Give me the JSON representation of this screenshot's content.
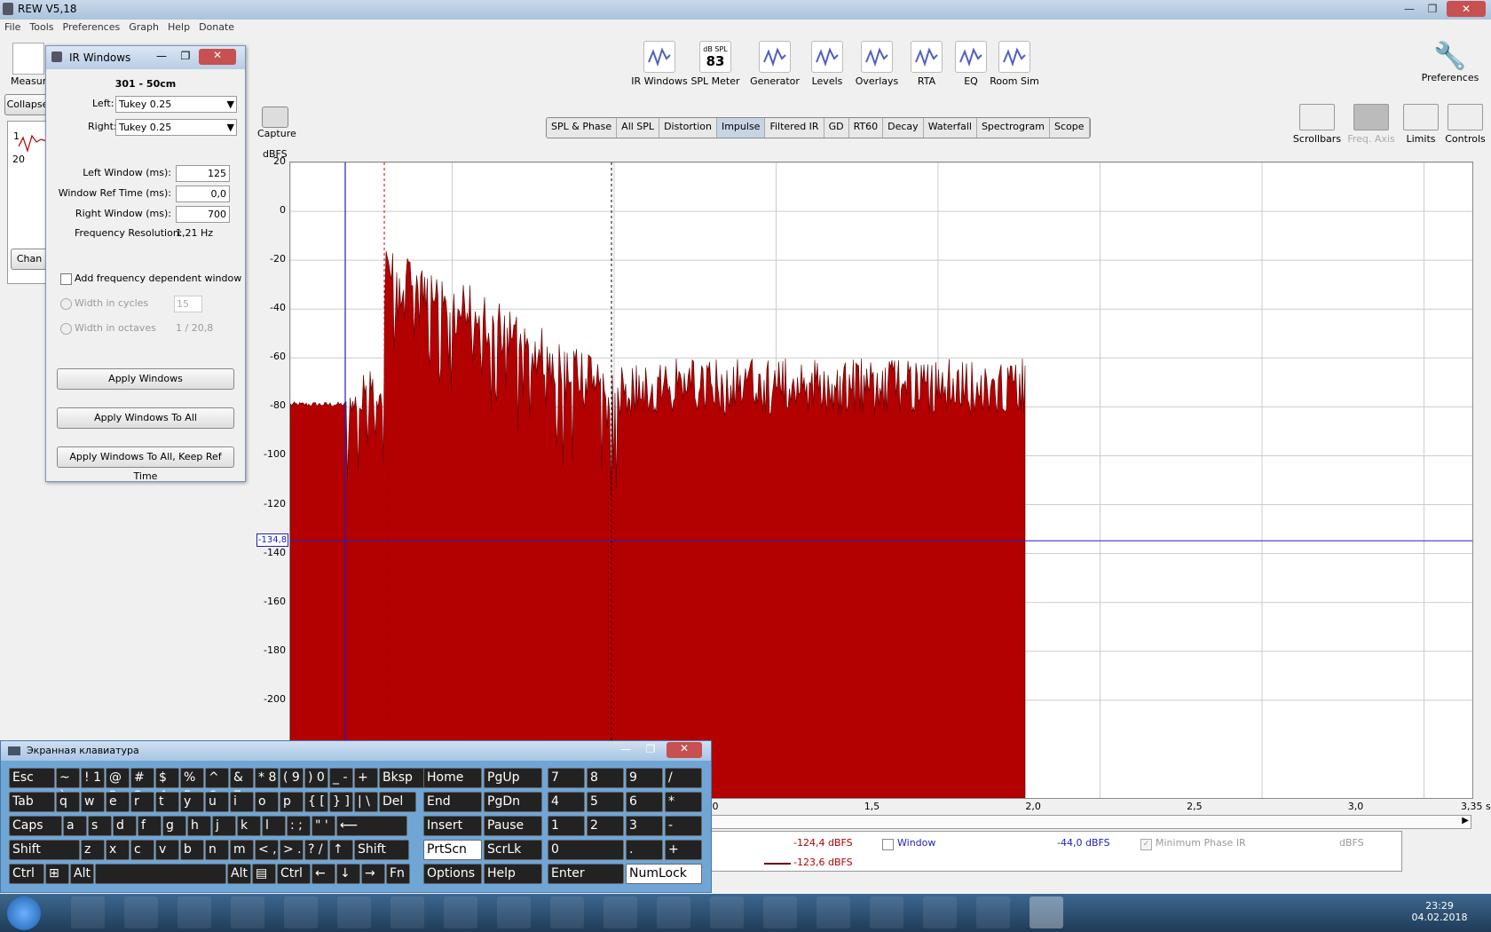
{
  "window": {
    "title": "REW V5,18"
  },
  "menu": [
    "File",
    "Tools",
    "Preferences",
    "Graph",
    "Help",
    "Donate"
  ],
  "toolbar": [
    {
      "label": "IR Windows",
      "icon": "ir-windows-icon",
      "x": 743
    },
    {
      "label": "SPL Meter",
      "icon": "spl-meter-icon",
      "x": 806,
      "sub": "dB SPL",
      "value": "83"
    },
    {
      "label": "Generator",
      "icon": "generator-icon",
      "x": 873
    },
    {
      "label": "Levels",
      "icon": "levels-icon",
      "x": 932
    },
    {
      "label": "Overlays",
      "icon": "overlays-icon",
      "x": 988
    },
    {
      "label": "RTA",
      "icon": "rta-icon",
      "x": 1044
    },
    {
      "label": "EQ",
      "icon": "eq-icon",
      "x": 1094
    },
    {
      "label": "Room Sim",
      "icon": "room-sim-icon",
      "x": 1143
    }
  ],
  "preferences_label": "Preferences",
  "capture": {
    "label": "Capture",
    "unit": "dBFS"
  },
  "tabs": [
    "SPL & Phase",
    "All SPL",
    "Distortion",
    "Impulse",
    "Filtered IR",
    "GD",
    "RT60",
    "Decay",
    "Waterfall",
    "Spectrogram",
    "Scope"
  ],
  "active_tab": "Impulse",
  "right_tools": [
    "Scrollbars",
    "Freq. Axis",
    "Limits",
    "Controls"
  ],
  "left_panel": {
    "measure": "Measure",
    "collapse": "Collapse",
    "change": "Chan",
    "small_tick_1": "1",
    "small_tick_20": "20"
  },
  "chart_data": {
    "type": "area",
    "ylabel": "dBFS",
    "xlabel": "s",
    "y_ticks": [
      20,
      0,
      -20,
      -40,
      -60,
      -80,
      -100,
      -120,
      -140,
      -160,
      -180,
      -200
    ],
    "x_ticks": [
      {
        "label": "1,0",
        "v": 1.0
      },
      {
        "label": "1,5",
        "v": 1.5
      },
      {
        "label": "2,0",
        "v": 2.0
      },
      {
        "label": "2,5",
        "v": 2.5
      },
      {
        "label": "3,0",
        "v": 3.0
      },
      {
        "label": "3,35 s",
        "v": 3.35
      }
    ],
    "cursor_readout": "-134,8",
    "color": "#b30000",
    "peak_db": 0
  },
  "ir_windows": {
    "title": "IR Windows",
    "measurement": "301 - 50cm",
    "left_label": "Left:",
    "left_value": "Tukey 0.25",
    "right_label": "Right:",
    "right_value": "Tukey 0.25",
    "left_window_label": "Left Window (ms):",
    "left_window_value": "125",
    "ref_time_label": "Window Ref Time (ms):",
    "ref_time_value": "0,0",
    "right_window_label": "Right Window (ms):",
    "right_window_value": "700",
    "freq_res_label": "Frequency Resolution:",
    "freq_res_value": "1,21 Hz",
    "freq_dep_label": "Add frequency dependent window",
    "width_cycles_label": "Width in cycles",
    "width_cycles_value": "15",
    "width_octaves_label": "Width in octaves",
    "width_octaves_value": "1 / 20,8",
    "apply": "Apply Windows",
    "apply_all": "Apply Windows To All",
    "apply_all_keep": "Apply Windows To All, Keep Ref Time"
  },
  "legend": {
    "v1": "-124,4 dBFS",
    "v2": "-123,6 dBFS",
    "window_label": "Window",
    "window_value": "-44,0 dBFS",
    "minphase_label": "Minimum Phase IR",
    "minphase_unit": "dBFS"
  },
  "keyboard": {
    "title": "Экранная клавиатура",
    "rows": [
      [
        "Esc",
        "~ `",
        "! 1",
        "@ 2",
        "# 3",
        "$ 4",
        "% 5",
        "^ 6",
        "& 7",
        "* 8",
        "( 9",
        ") 0",
        "_ -",
        "+ =",
        "Bksp"
      ],
      [
        "Tab",
        "q",
        "w",
        "e",
        "r",
        "t",
        "y",
        "u",
        "i",
        "o",
        "p",
        "{ [",
        "} ]",
        "| \\",
        "Del"
      ],
      [
        "Caps",
        "a",
        "s",
        "d",
        "f",
        "g",
        "h",
        "j",
        "k",
        "l",
        ": ;",
        "\" '",
        "⟵"
      ],
      [
        "Shift",
        "z",
        "x",
        "c",
        "v",
        "b",
        "n",
        "m",
        "< ,",
        "> .",
        "? /",
        "↑",
        "Shift"
      ],
      [
        "Ctrl",
        "⊞",
        "Alt",
        "",
        "Alt",
        "▤",
        "Ctrl",
        "←",
        "↓",
        "→",
        "Fn"
      ]
    ],
    "nav": [
      [
        "Home",
        "PgUp"
      ],
      [
        "End",
        "PgDn"
      ],
      [
        "Insert",
        "Pause"
      ],
      [
        "PrtScn",
        "ScrLk"
      ],
      [
        "Options",
        "Help"
      ]
    ],
    "numpad": [
      [
        "7",
        "8",
        "9",
        "/"
      ],
      [
        "4",
        "5",
        "6",
        "*"
      ],
      [
        "1",
        "2",
        "3",
        "-"
      ],
      [
        "0",
        ".",
        "+"
      ],
      [
        "Enter",
        "NumLock"
      ]
    ]
  },
  "clock": {
    "time": "23:29",
    "date": "04.02.2018"
  }
}
